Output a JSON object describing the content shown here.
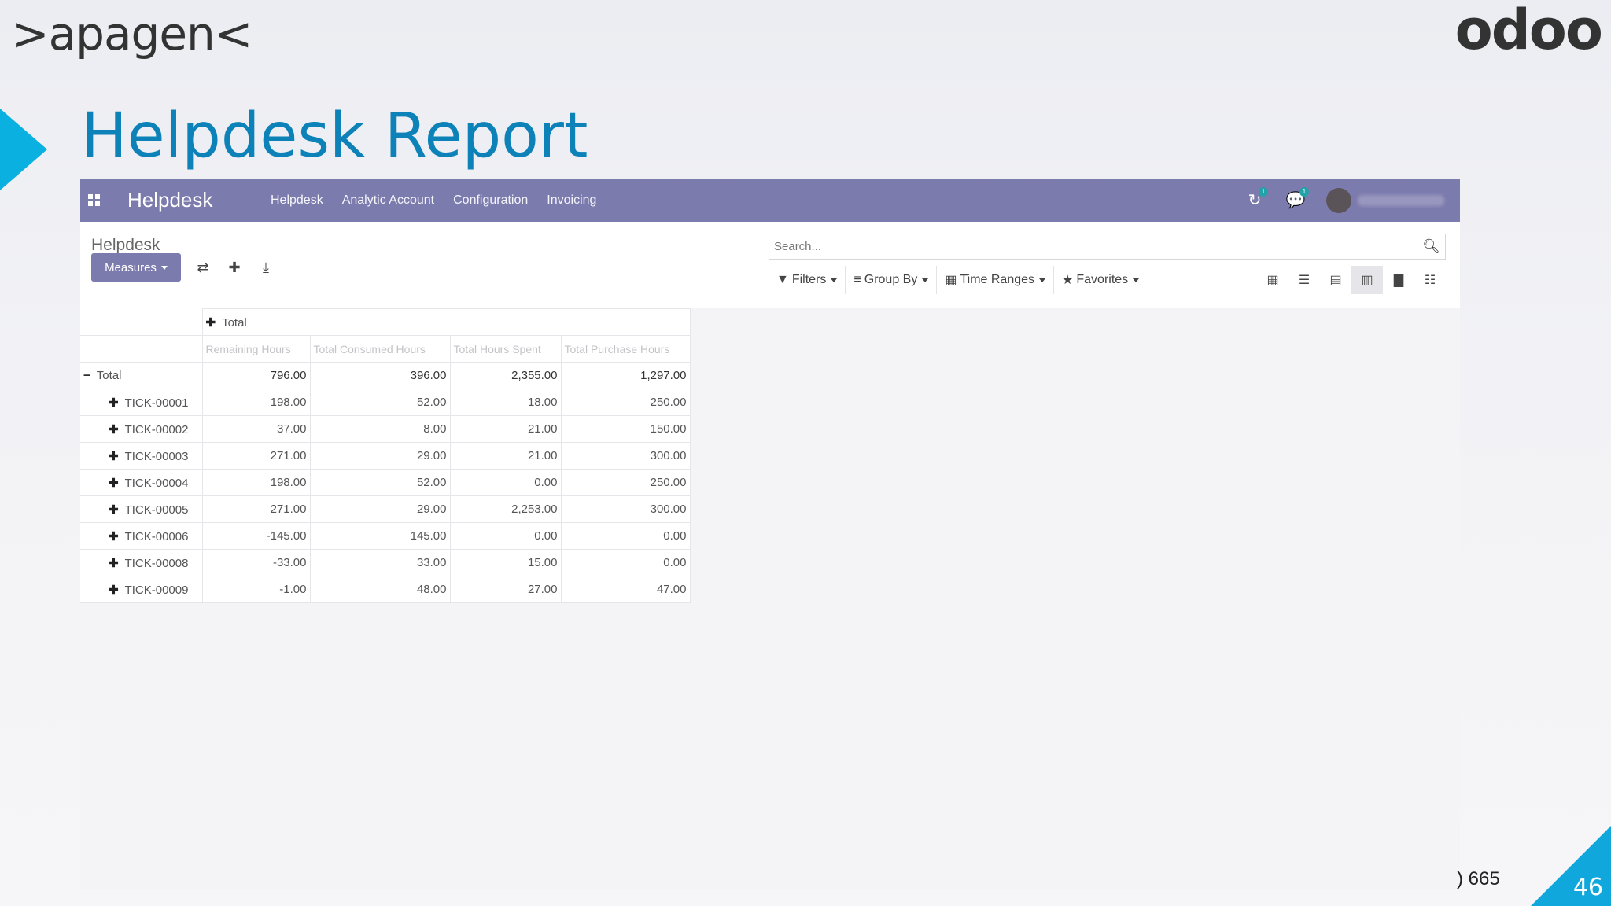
{
  "slide": {
    "brand_left": ">apagen<",
    "brand_right": "odoo",
    "title": "Helpdesk Report",
    "page_number": "46",
    "footer_text": ") 665"
  },
  "navbar": {
    "app_name": "Helpdesk",
    "menu": [
      "Helpdesk",
      "Analytic Account",
      "Configuration",
      "Invoicing"
    ],
    "activity_badge": "1",
    "message_badge": "1"
  },
  "control_panel": {
    "breadcrumb": "Helpdesk",
    "measures_label": "Measures",
    "search_placeholder": "Search...",
    "filters": [
      "Filters",
      "Group By",
      "Time Ranges",
      "Favorites"
    ]
  },
  "pivot": {
    "column_group": "Total",
    "measures": [
      "Remaining Hours",
      "Total Consumed Hours",
      "Total Hours Spent",
      "Total Purchase Hours"
    ],
    "total_row": {
      "label": "Total",
      "values": [
        "796.00",
        "396.00",
        "2,355.00",
        "1,297.00"
      ]
    },
    "rows": [
      {
        "label": "TICK-00001",
        "values": [
          "198.00",
          "52.00",
          "18.00",
          "250.00"
        ]
      },
      {
        "label": "TICK-00002",
        "values": [
          "37.00",
          "8.00",
          "21.00",
          "150.00"
        ]
      },
      {
        "label": "TICK-00003",
        "values": [
          "271.00",
          "29.00",
          "21.00",
          "300.00"
        ]
      },
      {
        "label": "TICK-00004",
        "values": [
          "198.00",
          "52.00",
          "0.00",
          "250.00"
        ]
      },
      {
        "label": "TICK-00005",
        "values": [
          "271.00",
          "29.00",
          "2,253.00",
          "300.00"
        ]
      },
      {
        "label": "TICK-00006",
        "values": [
          "-145.00",
          "145.00",
          "0.00",
          "0.00"
        ]
      },
      {
        "label": "TICK-00008",
        "values": [
          "-33.00",
          "33.00",
          "15.00",
          "0.00"
        ]
      },
      {
        "label": "TICK-00009",
        "values": [
          "-1.00",
          "48.00",
          "27.00",
          "47.00"
        ]
      }
    ]
  }
}
